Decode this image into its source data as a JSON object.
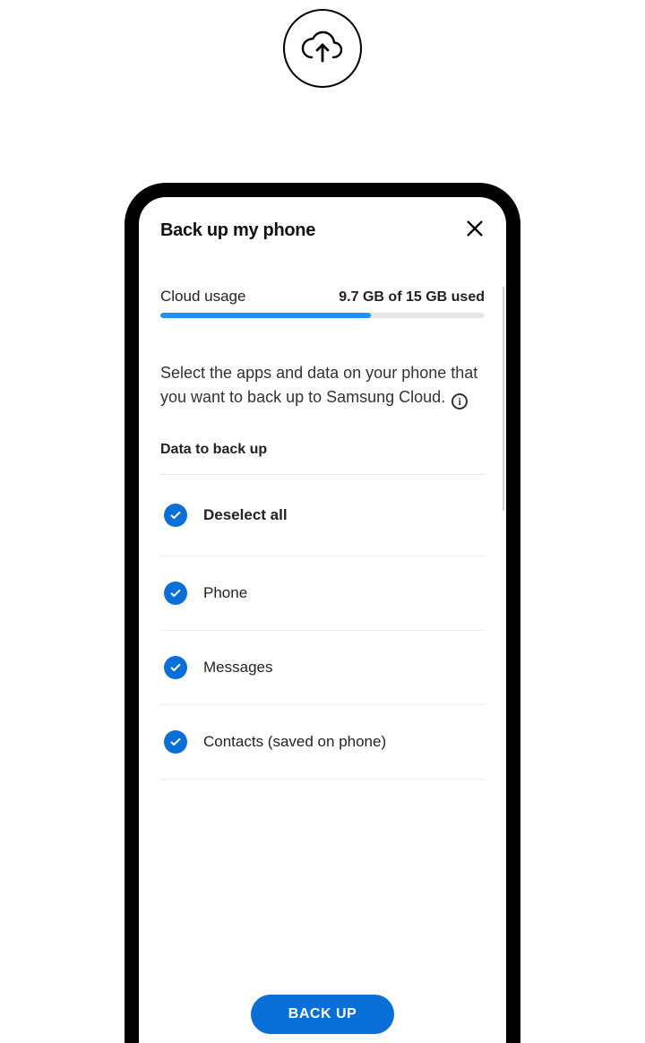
{
  "top_icon": "cloud-upload-icon",
  "screen": {
    "title": "Back up my phone",
    "close_icon": "close-icon",
    "usage": {
      "label": "Cloud usage",
      "text": "9.7 GB of 15 GB used",
      "percent": 65
    },
    "instructions": {
      "text": "Select the apps and data on your phone that you want to back up to Samsung Cloud.",
      "info_icon": "info-icon",
      "info_char": "i"
    },
    "data_header": "Data to back up",
    "items": [
      {
        "label": "Deselect all",
        "checked": true,
        "bold": true
      },
      {
        "label": "Phone",
        "checked": true,
        "bold": false
      },
      {
        "label": "Messages",
        "checked": true,
        "bold": false
      },
      {
        "label": "Contacts (saved on phone)",
        "checked": true,
        "bold": false
      }
    ],
    "backup_button": "BACK UP"
  },
  "colors": {
    "accent": "#0b6fd8",
    "progress": "#1e90ff"
  }
}
